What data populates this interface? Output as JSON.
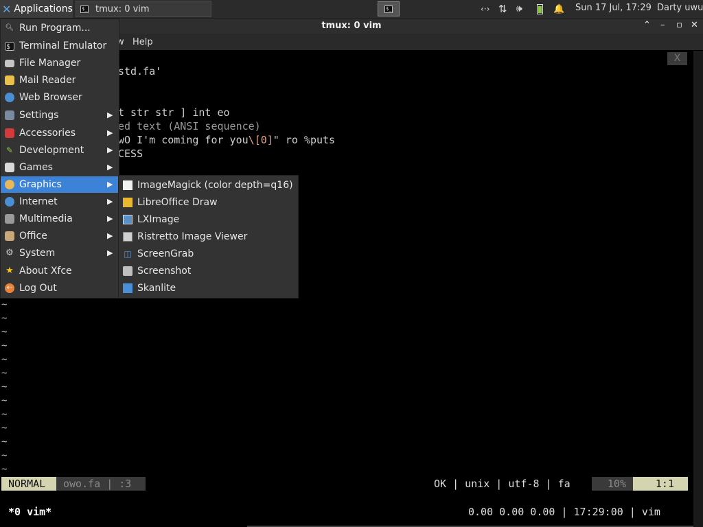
{
  "panel": {
    "applications_label": "Applications",
    "task_title": "tmux: 0 vim",
    "clock": "Sun 17 Jul, 17:29",
    "user": "Darty uwu"
  },
  "window": {
    "title": "tmux: 0 vim",
    "menu_view_fragment": "w",
    "menu_help": "Help",
    "close_tab": "X"
  },
  "editor": {
    "lines": {
      "l1": "std.fa'",
      "l2": "t str str ] int eo",
      "l3": "ed text (ANSI sequence)",
      "l4_pre": "wO I'm coming for you",
      "l4_esc": "\\[0]",
      "l4_post": "\" ro %puts",
      "l5": "CESS"
    },
    "tilde": "~",
    "status": {
      "mode": "NORMAL",
      "fileinfo": "owo.fa | :3",
      "right": "OK | unix | utf-8 | fa",
      "percent": "10%",
      "position": "1:1"
    },
    "tmux": {
      "window": "*0 vim*",
      "right": "0.00 0.00 0.00 | 17:29:00 | vim"
    }
  },
  "app_menu": {
    "items": [
      {
        "label": "Run Program...",
        "icon": "search-icon"
      },
      {
        "label": "Terminal Emulator",
        "icon": "terminal-icon"
      },
      {
        "label": "File Manager",
        "icon": "folder-icon"
      },
      {
        "label": "Mail Reader",
        "icon": "mail-icon"
      },
      {
        "label": "Web Browser",
        "icon": "globe-icon"
      },
      {
        "label": "Settings",
        "icon": "settings-icon"
      },
      {
        "label": "Accessories",
        "icon": "accessories-icon"
      },
      {
        "label": "Development",
        "icon": "development-icon"
      },
      {
        "label": "Games",
        "icon": "games-icon"
      },
      {
        "label": "Graphics",
        "icon": "graphics-icon"
      },
      {
        "label": "Internet",
        "icon": "globe-icon"
      },
      {
        "label": "Multimedia",
        "icon": "multimedia-icon"
      },
      {
        "label": "Office",
        "icon": "office-icon"
      },
      {
        "label": "System",
        "icon": "gear-icon"
      },
      {
        "label": "About Xfce",
        "icon": "star-icon"
      },
      {
        "label": "Log Out",
        "icon": "logout-icon"
      }
    ]
  },
  "graphics_menu": {
    "items": [
      {
        "label": "ImageMagick (color depth=q16)",
        "icon": "imagemagick-icon"
      },
      {
        "label": "LibreOffice Draw",
        "icon": "draw-icon"
      },
      {
        "label": "LXImage",
        "icon": "image-viewer-icon"
      },
      {
        "label": "Ristretto Image Viewer",
        "icon": "image-viewer-icon"
      },
      {
        "label": "ScreenGrab",
        "icon": "screengrab-icon"
      },
      {
        "label": "Screenshot",
        "icon": "camera-icon"
      },
      {
        "label": "Skanlite",
        "icon": "scanner-icon"
      }
    ]
  },
  "colors": {
    "menu_highlight": "#3c82d7",
    "status_mode_bg": "#d4d4b0",
    "escape_text": "#e0a38a"
  }
}
